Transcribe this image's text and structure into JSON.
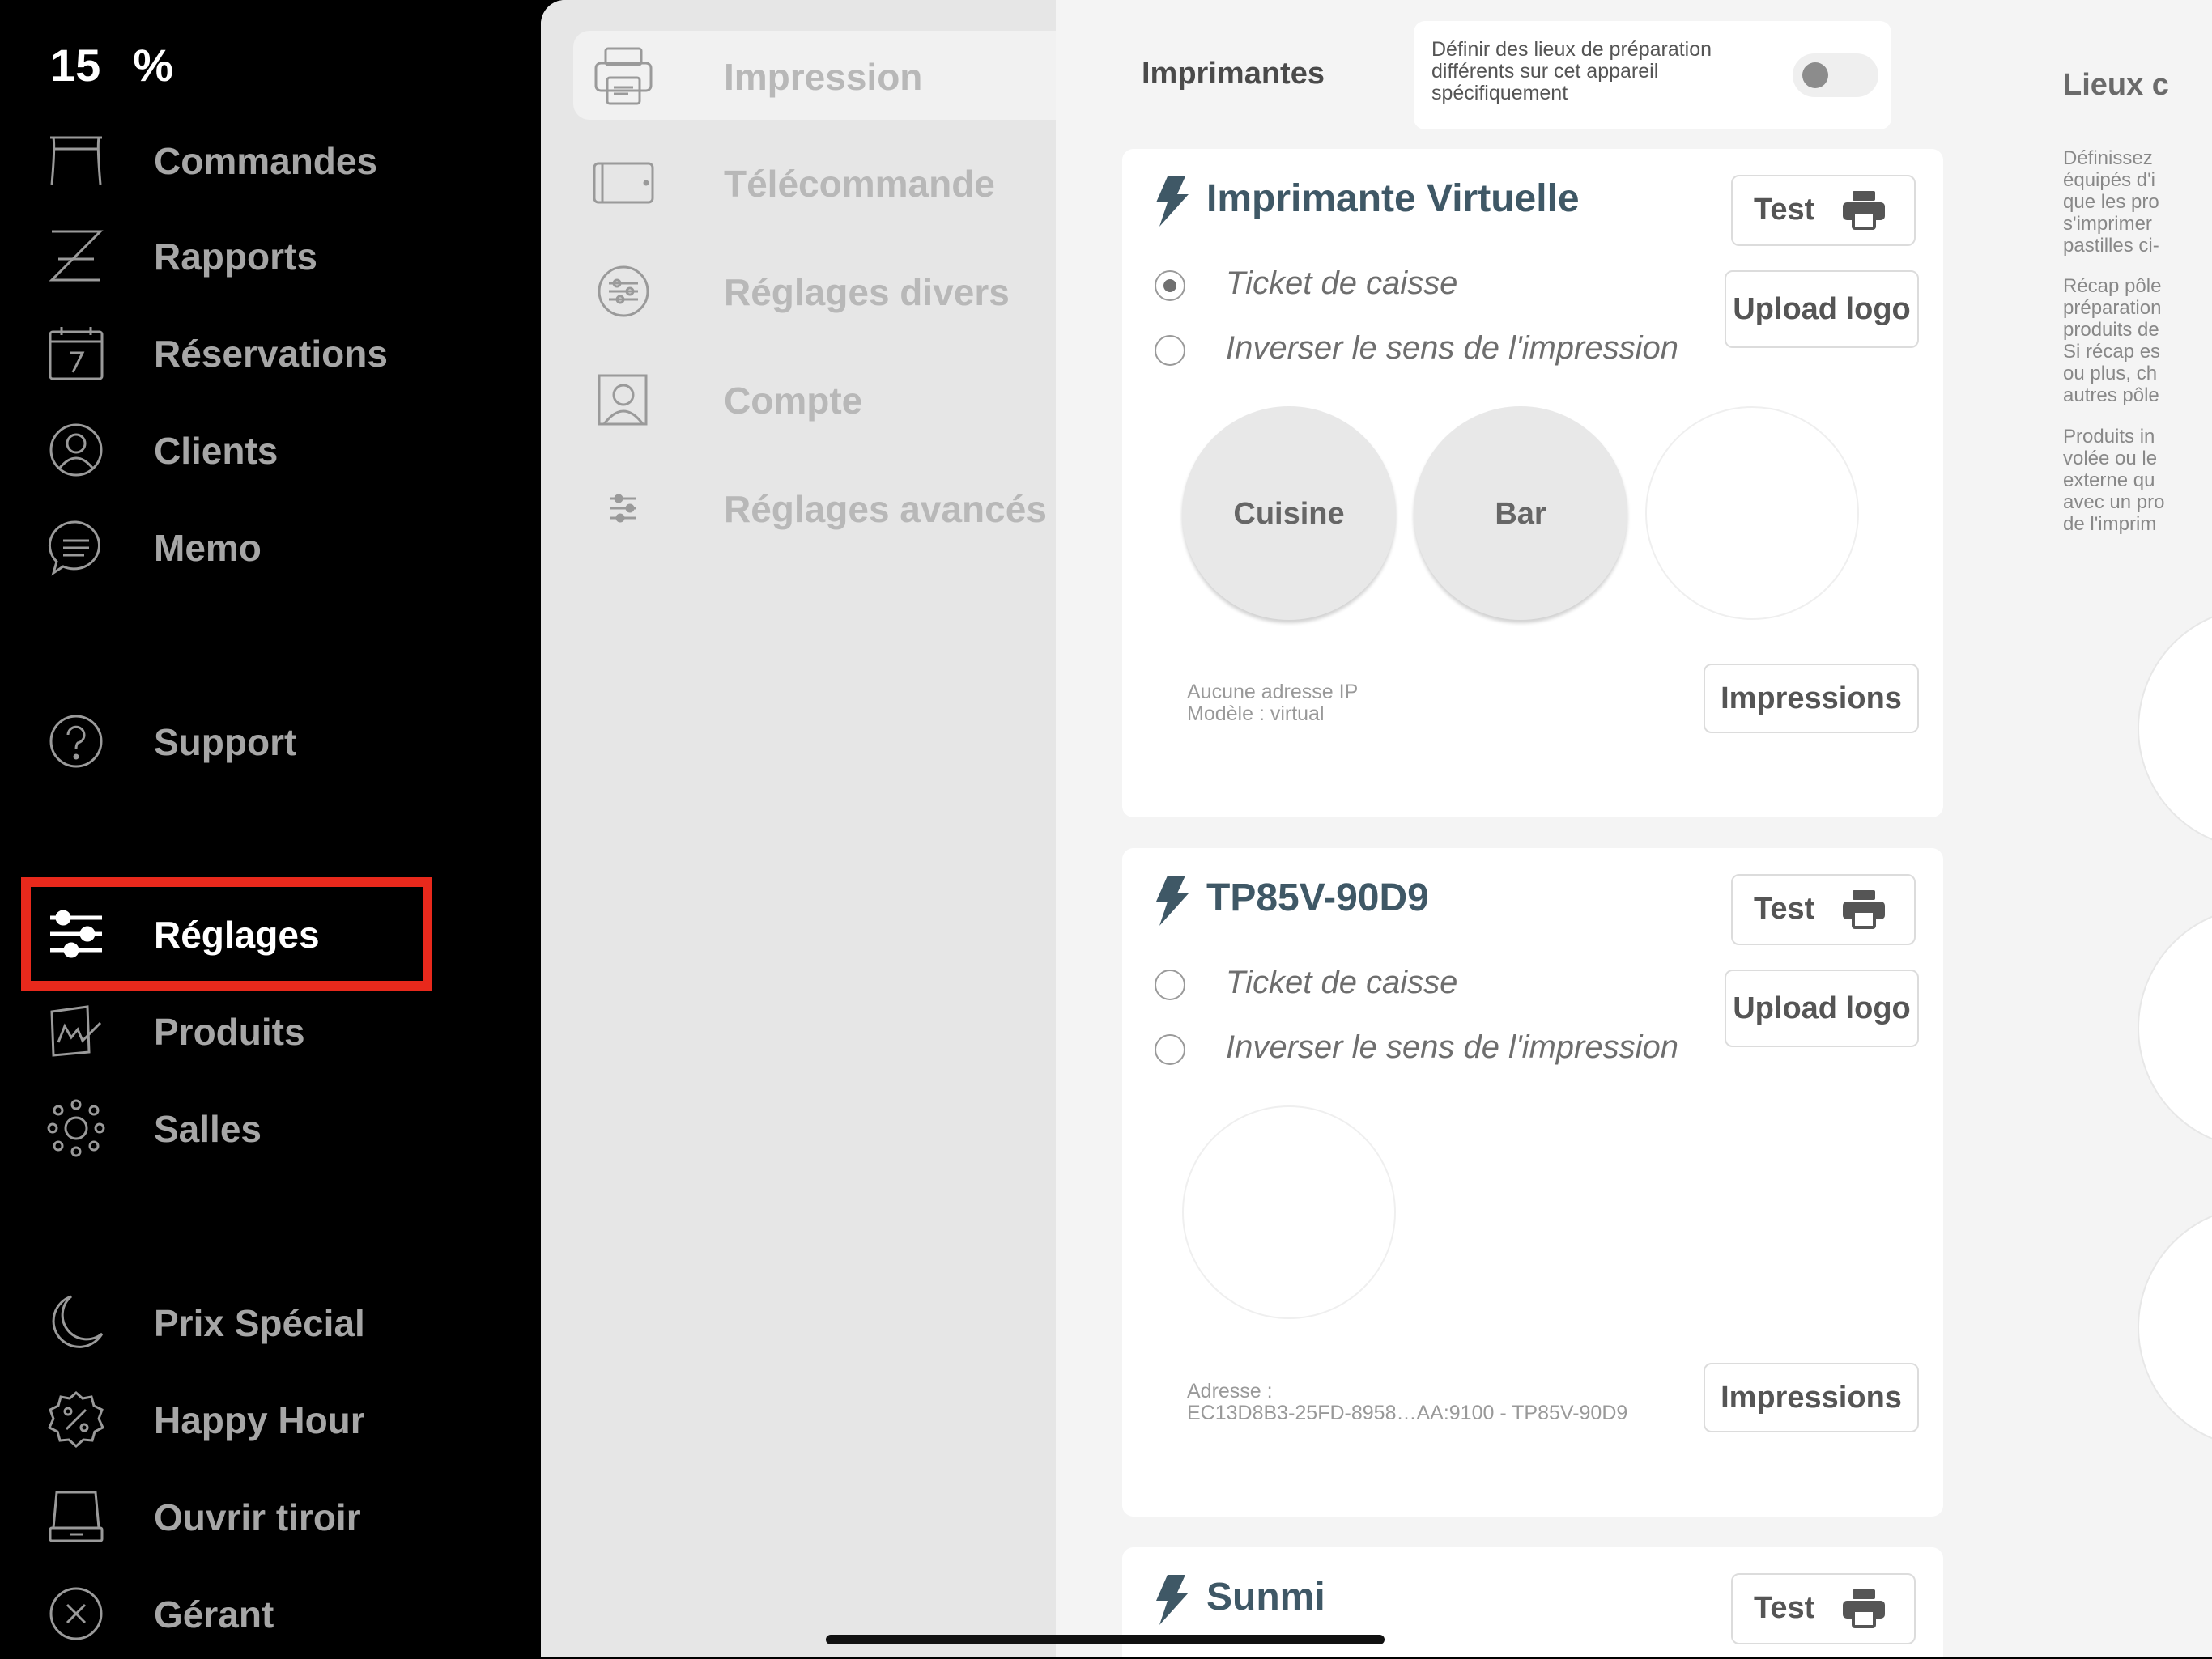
{
  "status": {
    "battery_level": "15",
    "battery_unit": "%"
  },
  "sidebar": {
    "items": [
      {
        "label": "Commandes",
        "icon": "table-icon"
      },
      {
        "label": "Rapports",
        "icon": "z-report-icon"
      },
      {
        "label": "Réservations",
        "icon": "calendar-icon"
      },
      {
        "label": "Clients",
        "icon": "user-icon"
      },
      {
        "label": "Memo",
        "icon": "chat-icon"
      },
      {
        "label": "Support",
        "icon": "help-icon"
      },
      {
        "label": "Réglages",
        "icon": "sliders-icon",
        "active": true
      },
      {
        "label": "Produits",
        "icon": "products-icon"
      },
      {
        "label": "Salles",
        "icon": "rooms-icon"
      },
      {
        "label": "Prix Spécial",
        "icon": "moon-icon"
      },
      {
        "label": "Happy Hour",
        "icon": "percent-badge-icon"
      },
      {
        "label": "Ouvrir tiroir",
        "icon": "drawer-icon"
      },
      {
        "label": "Gérant",
        "icon": "close-circle-icon"
      }
    ]
  },
  "submenu": {
    "items": [
      {
        "label": "Impression",
        "icon": "printer-icon",
        "active": true
      },
      {
        "label": "Télécommande",
        "icon": "tablet-icon"
      },
      {
        "label": "Réglages divers",
        "icon": "settings-circle-icon"
      },
      {
        "label": "Compte",
        "icon": "account-icon"
      },
      {
        "label": "Réglages avancés",
        "icon": "sliders-icon"
      }
    ]
  },
  "printers_section": {
    "title": "Imprimantes",
    "toggle_label": "Définir des lieux de préparation différents sur cet appareil spécifiquement",
    "toggle_on": false
  },
  "printers": [
    {
      "name": "Imprimante Virtuelle",
      "test_label": "Test",
      "upload_logo_label": "Upload logo",
      "impressions_label": "Impressions",
      "options": [
        {
          "label": "Ticket de caisse",
          "selected": true
        },
        {
          "label": "Inverser le sens de l'impression",
          "selected": false
        }
      ],
      "places": [
        "Cuisine",
        "Bar",
        ""
      ],
      "info_line1": "Aucune adresse IP",
      "info_line2": "Modèle : virtual"
    },
    {
      "name": "TP85V-90D9",
      "test_label": "Test",
      "upload_logo_label": "Upload logo",
      "impressions_label": "Impressions",
      "options": [
        {
          "label": "Ticket de caisse",
          "selected": false
        },
        {
          "label": "Inverser le sens de l'impression",
          "selected": false
        }
      ],
      "places": [
        ""
      ],
      "info_line1": "Adresse :",
      "info_line2": "EC13D8B3-25FD-8958…AA:9100 - TP85V-90D9"
    },
    {
      "name": "Sunmi",
      "test_label": "Test"
    }
  ],
  "right_panel": {
    "title": "Lieux c",
    "para1": [
      "Définissez",
      "équipés d'i",
      "que les pro",
      "s'imprimer",
      "pastilles ci-"
    ],
    "para2": [
      "Récap pôle",
      "préparation",
      "produits de",
      "Si récap es",
      "ou plus, ch",
      "autres pôle"
    ],
    "para3": [
      "Produits in",
      "volée ou le",
      "externe qu",
      "avec un pro",
      "de l'imprim"
    ]
  }
}
